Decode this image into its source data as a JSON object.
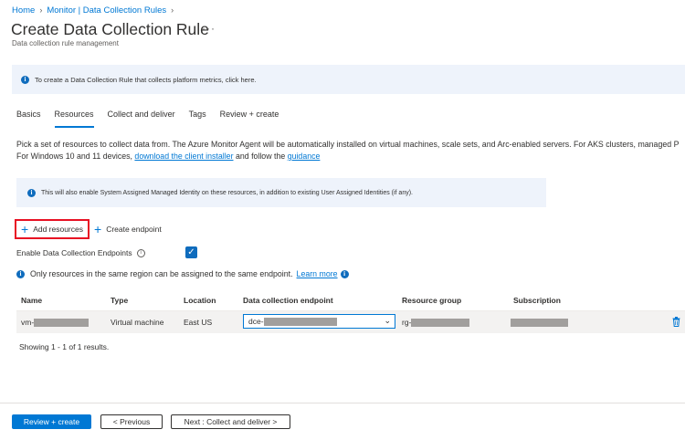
{
  "breadcrumb": {
    "items": [
      "Home",
      "Monitor | Data Collection Rules"
    ]
  },
  "page": {
    "title": "Create Data Collection Rule",
    "subtitle": "Data collection rule management"
  },
  "info_banner": {
    "text": "To create a Data Collection Rule that collects platform metrics, click here."
  },
  "tabs": [
    "Basics",
    "Resources",
    "Collect and deliver",
    "Tags",
    "Review + create"
  ],
  "description": {
    "line1": "Pick a set of resources to collect data from. The Azure Monitor Agent will be automatically installed on virtual machines, scale sets, and Arc-enabled servers. For AKS clusters, managed P",
    "line2_prefix": "For Windows 10 and 11 devices, ",
    "line2_link1": "download the client installer",
    "line2_mid": " and follow the ",
    "line2_link2": "guidance"
  },
  "msi_banner": {
    "text": "This will also enable System Assigned Managed Identity on these resources, in addition to existing User Assigned Identities (if any)."
  },
  "toolbar": {
    "add_resources": "Add resources",
    "create_endpoint": "Create endpoint"
  },
  "endpoints": {
    "label": "Enable Data Collection Endpoints",
    "checked": true
  },
  "region_note": {
    "text": "Only resources in the same region can be assigned to the same endpoint.",
    "link": "Learn more"
  },
  "table": {
    "columns": [
      "Name",
      "Type",
      "Location",
      "Data collection endpoint",
      "Resource group",
      "Subscription"
    ],
    "rows": [
      {
        "name": "vm-",
        "type": "Virtual machine",
        "location": "East US",
        "endpoint": "dce-",
        "resource_group": "rg-"
      }
    ]
  },
  "result_count": "Showing 1 - 1 of 1 results.",
  "footer": {
    "review_create": "Review + create",
    "previous": "< Previous",
    "next": "Next : Collect and deliver >"
  },
  "colors": {
    "accent": "#0078d4",
    "banner_bg": "#eef3fb",
    "highlight": "#e81123",
    "row_bg": "#f3f2f1"
  }
}
